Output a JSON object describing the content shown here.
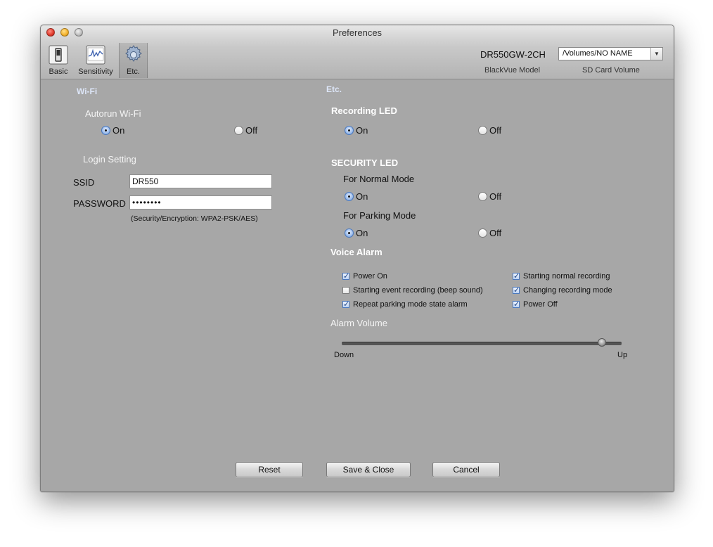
{
  "window": {
    "title": "Preferences"
  },
  "toolbar": {
    "items": [
      {
        "label": "Basic",
        "icon": "switch-icon"
      },
      {
        "label": "Sensitivity",
        "icon": "waveform-icon"
      },
      {
        "label": "Etc.",
        "icon": "gear-icon",
        "selected": true
      }
    ],
    "model_name": "DR550GW-2CH",
    "model_caption": "BlackVue Model",
    "sd_card_value": "/Volumes/NO NAME",
    "sd_card_caption": "SD Card Volume"
  },
  "wifi": {
    "header": "Wi-Fi",
    "autorun_label": "Autorun Wi-Fi",
    "on_label": "On",
    "off_label": "Off",
    "autorun_value": "On",
    "login_label": "Login Setting",
    "ssid_label": "SSID",
    "ssid_value": "DR550",
    "password_label": "PASSWORD",
    "password_value": "••••••••",
    "encryption_note": "(Security/Encryption: WPA2-PSK/AES)"
  },
  "etc": {
    "header": "Etc.",
    "recording_led": {
      "label": "Recording LED",
      "on": "On",
      "off": "Off",
      "value": "On"
    },
    "security_led": {
      "label": "SECURITY LED",
      "normal": {
        "label": "For Normal Mode",
        "on": "On",
        "off": "Off",
        "value": "On"
      },
      "parking": {
        "label": "For Parking Mode",
        "on": "On",
        "off": "Off",
        "value": "On"
      }
    },
    "voice_alarm": {
      "label": "Voice Alarm",
      "items": [
        {
          "label": "Power On",
          "checked": true
        },
        {
          "label": "Starting event recording (beep sound)",
          "checked": false
        },
        {
          "label": "Repeat parking mode state alarm",
          "checked": true
        },
        {
          "label": "Starting normal recording",
          "checked": true
        },
        {
          "label": "Changing recording mode",
          "checked": true
        },
        {
          "label": "Power Off",
          "checked": true
        }
      ]
    },
    "alarm_volume": {
      "label": "Alarm Volume",
      "min_label": "Down",
      "max_label": "Up",
      "level": 0.93
    }
  },
  "buttons": {
    "reset": "Reset",
    "save_close": "Save & Close",
    "cancel": "Cancel"
  },
  "colors": {
    "window_bg": "#a7a7a7",
    "section_header_blue": "#dde6f8",
    "radio_selected": "#5a87c8"
  }
}
